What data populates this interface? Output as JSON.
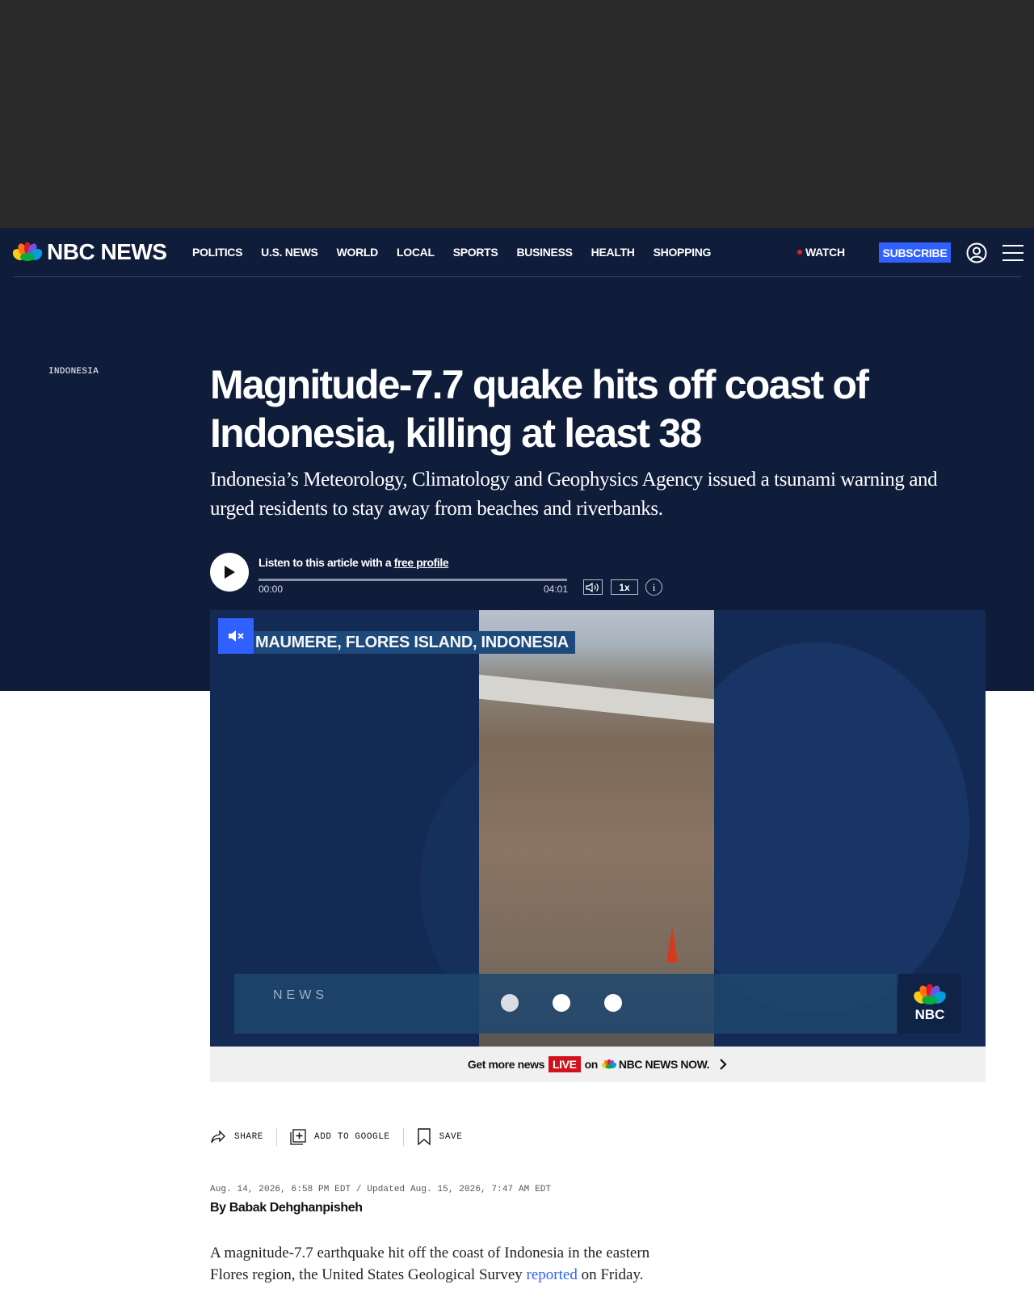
{
  "header": {
    "logo_text": "NBC NEWS",
    "nav": [
      "POLITICS",
      "U.S. NEWS",
      "WORLD",
      "LOCAL",
      "SPORTS",
      "BUSINESS",
      "HEALTH",
      "SHOPPING"
    ],
    "watch_label": "WATCH",
    "subscribe_label": "SUBSCRIBE"
  },
  "article": {
    "category": "INDONESIA",
    "headline": "Magnitude-7.7 quake hits off coast of Indonesia, killing at least 38",
    "dek": "Indonesia’s Meteorology, Climatology and Geophysics Agency issued a tsunami warning and urged residents to stay away from beaches and riverbanks.",
    "dateline": "Aug. 14, 2026, 6:58 PM EDT / Updated Aug. 15, 2026, 7:47 AM EDT",
    "byline": "By Babak Dehghanpisheh",
    "body_before_link": "A magnitude-7.7 earthquake hit off the coast of Indonesia in the eastern Flores region, the United States Geological Survey ",
    "body_link": "reported",
    "body_after_link": " on Friday."
  },
  "audio": {
    "listen_prefix": "Listen to this article with a ",
    "listen_link": "free profile",
    "time_current": "00:00",
    "time_total": "04:01",
    "speed": "1x",
    "info": "i",
    "progress": 0
  },
  "video": {
    "location": "MAUMERE, FLORES ISLAND, INDONESIA",
    "lower_third": "NEWS",
    "bug_text": "NBC"
  },
  "live_bar": {
    "prefix": "Get more news",
    "live": "LIVE",
    "on": "on",
    "brand": "NBC NEWS NOW."
  },
  "share": {
    "share_label": "SHARE",
    "google_label": "ADD TO GOOGLE",
    "save_label": "SAVE"
  },
  "colors": {
    "hero_bg": "#0f1d3b",
    "accent_blue": "#3061ff",
    "live_red": "#d1111d"
  }
}
